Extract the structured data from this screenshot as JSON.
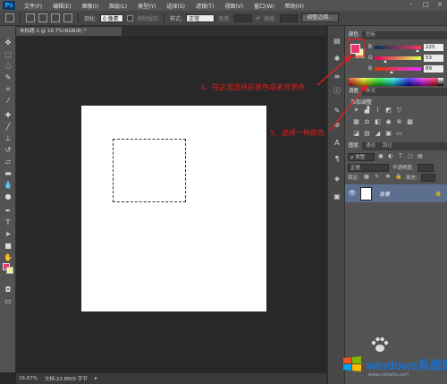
{
  "app": {
    "logo": "Ps"
  },
  "menu": [
    "文件(F)",
    "编辑(E)",
    "图像(I)",
    "图层(L)",
    "类型(Y)",
    "选择(S)",
    "滤镜(T)",
    "视图(V)",
    "窗口(W)",
    "帮助(H)"
  ],
  "window_controls": [
    "-",
    "□",
    "×"
  ],
  "options": {
    "feather_label": "羽化:",
    "feather_value": "0 像素",
    "antialias_label": "消除锯齿",
    "style_label": "样式:",
    "style_value": "正常",
    "width_label": "宽度:",
    "height_label": "高度:",
    "refine_button": "调整边缘..."
  },
  "document": {
    "tab_label": "未标题-1 @ 16.7%(RGB/8) *",
    "zoom": "16.67%",
    "doc_info": "文档:23.8M/0 字节"
  },
  "color_panel": {
    "tabs": [
      "颜色",
      "色板"
    ],
    "fg_color": "#e8386c",
    "bg_color": "#f6f0a0",
    "r": {
      "label": "R",
      "value": "225"
    },
    "g": {
      "label": "G",
      "value": "53"
    },
    "b": {
      "label": "B",
      "value": "89"
    }
  },
  "adjust_panel": {
    "tabs": [
      "调整",
      "样式"
    ],
    "title": "添加调整"
  },
  "layers_panel": {
    "tabs": [
      "图层",
      "通道",
      "路径"
    ],
    "filter_label": "ρ 类型",
    "blend_mode": "正常",
    "opacity_label": "不透明度:",
    "lock_label": "锁定:",
    "fill_label": "填充:",
    "layer_name": "背景"
  },
  "annotations": {
    "step4": "4、在这里选择前景色或者背景色",
    "step5": "5、选择一种颜色"
  },
  "watermark": {
    "brand": "windows系统家园",
    "subtitle": "www.ruihaitu.com"
  }
}
